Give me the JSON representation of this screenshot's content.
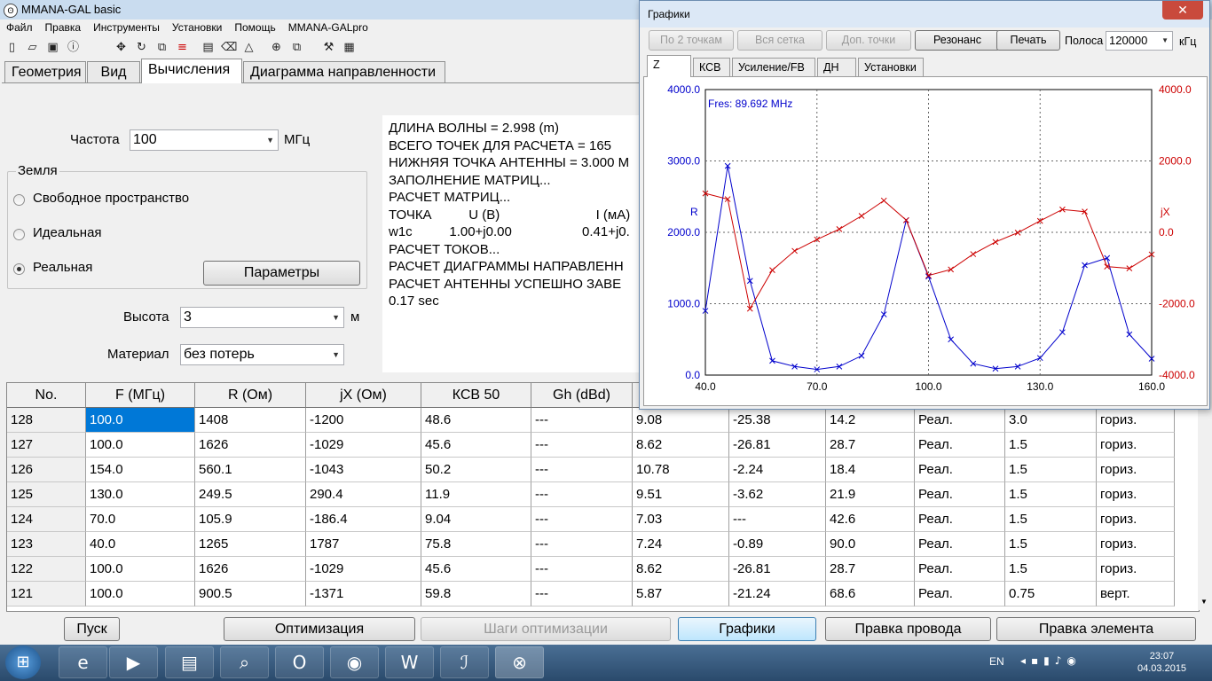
{
  "main": {
    "title": "MMANA-GAL basic",
    "menu": [
      "Файл",
      "Правка",
      "Инструменты",
      "Установки",
      "Помощь",
      "MMANA-GALpro"
    ],
    "toolbar_icons": [
      "new-file-icon",
      "open-folder-icon",
      "save-icon",
      "info-icon",
      "move-icon",
      "rotate-icon",
      "edit-geometry-icon",
      "wires-icon",
      "page-icon",
      "erase-icon",
      "triangle-icon",
      "target-icon",
      "copy-icon",
      "tools-icon",
      "calculator-icon"
    ],
    "tabs": [
      "Геометрия",
      "Вид",
      "Вычисления",
      "Диаграмма направленности"
    ],
    "active_tab": "Вычисления"
  },
  "calc": {
    "freq_label": "Частота",
    "freq_value": "100",
    "freq_unit": "МГц",
    "ground_group": "Земля",
    "ground_options": [
      "Свободное пространство",
      "Идеальная",
      "Реальная"
    ],
    "ground_selected": "Реальная",
    "params_button": "Параметры",
    "height_label": "Высота",
    "height_value": "3",
    "height_unit": "м",
    "material_label": "Материал",
    "material_value": "без потерь"
  },
  "log_lines": [
    "ДЛИНА ВОЛНЫ = 2.998 (m)",
    "ВСЕГО ТОЧЕК ДЛЯ РАСЧЕТА = 165",
    "НИЖНЯЯ ТОЧКА АНТЕННЫ = 3.000 M",
    "ЗАПОЛНЕНИЕ МАТРИЦ...",
    "РАСЧЕТ МАТРИЦ...",
    "ТОЧКА          U (B)                          I (мА)",
    "w1c          1.00+j0.00                   0.41+j0.",
    "РАСЧЕТ ТОКОВ...",
    "РАСЧЕТ ДИАГРАММЫ НАПРАВЛЕНН",
    "РАСЧЕТ АНТЕННЫ УСПЕШНО ЗАВЕ",
    "0.17 sec"
  ],
  "table": {
    "headers": [
      "No.",
      "F (МГц)",
      "R (Ом)",
      "jX (Ом)",
      "КСВ 50",
      "Gh (dBd)",
      "",
      "",
      "",
      "",
      "",
      ""
    ],
    "rows": [
      [
        "128",
        "100.0",
        "1408",
        "-1200",
        "48.6",
        "---",
        "9.08",
        "-25.38",
        "14.2",
        "Реал.",
        "3.0",
        "гориз."
      ],
      [
        "127",
        "100.0",
        "1626",
        "-1029",
        "45.6",
        "---",
        "8.62",
        "-26.81",
        "28.7",
        "Реал.",
        "1.5",
        "гориз."
      ],
      [
        "126",
        "154.0",
        "560.1",
        "-1043",
        "50.2",
        "---",
        "10.78",
        "-2.24",
        "18.4",
        "Реал.",
        "1.5",
        "гориз."
      ],
      [
        "125",
        "130.0",
        "249.5",
        "290.4",
        "11.9",
        "---",
        "9.51",
        "-3.62",
        "21.9",
        "Реал.",
        "1.5",
        "гориз."
      ],
      [
        "124",
        "70.0",
        "105.9",
        "-186.4",
        "9.04",
        "---",
        "7.03",
        " ---",
        "42.6",
        "Реал.",
        "1.5",
        "гориз."
      ],
      [
        "123",
        "40.0",
        "1265",
        "1787",
        "75.8",
        "---",
        "7.24",
        "-0.89",
        "90.0",
        "Реал.",
        "1.5",
        "гориз."
      ],
      [
        "122",
        "100.0",
        "1626",
        "-1029",
        "45.6",
        "---",
        "8.62",
        "-26.81",
        "28.7",
        "Реал.",
        "1.5",
        "гориз."
      ],
      [
        "121",
        "100.0",
        "900.5",
        "-1371",
        "59.8",
        "---",
        "5.87",
        "-21.24",
        "68.6",
        "Реал.",
        "0.75",
        "верт."
      ]
    ],
    "selected_cell": "100.0"
  },
  "bottom_buttons": [
    "Пуск",
    "Оптимизация",
    "Шаги оптимизации",
    "Графики",
    "Правка провода",
    "Правка элемента"
  ],
  "graph_window": {
    "title": "Графики",
    "close_glyph": "✕",
    "buttons": [
      "По 2 точкам",
      "Вся сетка",
      "Доп. точки",
      "Резонанс",
      "Печать"
    ],
    "band_label": "Полоса",
    "band_value": "120000",
    "band_unit": "кГц",
    "tabs": [
      "Z",
      "КСВ",
      "Усиление/FB",
      "ДН",
      "Установки"
    ],
    "active_tab": "Z"
  },
  "chart_data": {
    "type": "line",
    "annotation": "Fres: 89.692 MHz",
    "xlim": [
      40,
      160
    ],
    "x_ticks": [
      "40.0",
      "70.0",
      "100.0",
      "130.0",
      "160.0"
    ],
    "ylim_left": [
      0,
      4000
    ],
    "ylim_right": [
      -4000,
      4000
    ],
    "left_ticks": [
      "4000.0",
      "3000.0",
      "2000.0",
      "1000.0",
      "0.0"
    ],
    "right_ticks": [
      "4000.0",
      "2000.0",
      "0.0",
      "-2000.0",
      "-4000.0"
    ],
    "left_label": "R",
    "right_label": "jX",
    "grid": true,
    "series": [
      {
        "name": "R",
        "axis": "left",
        "color": "#0000cc",
        "x": [
          40,
          46,
          52,
          58,
          64,
          70,
          76,
          82,
          88,
          94,
          100,
          106,
          112,
          118,
          124,
          130,
          136,
          142,
          148,
          154,
          160
        ],
        "y": [
          900,
          2930,
          1320,
          200,
          120,
          80,
          120,
          270,
          850,
          2170,
          1380,
          500,
          160,
          90,
          120,
          240,
          600,
          1540,
          1640,
          570,
          230
        ]
      },
      {
        "name": "jX",
        "axis": "right",
        "color": "#cc0000",
        "x": [
          40,
          46,
          52,
          58,
          64,
          70,
          76,
          82,
          88,
          94,
          100,
          106,
          112,
          118,
          124,
          130,
          136,
          142,
          148,
          154,
          160
        ],
        "y": [
          1090,
          930,
          -2140,
          -1060,
          -520,
          -200,
          90,
          460,
          890,
          340,
          -1210,
          -1040,
          -610,
          -270,
          -10,
          320,
          640,
          580,
          -960,
          -1010,
          -620
        ]
      }
    ]
  }
}
